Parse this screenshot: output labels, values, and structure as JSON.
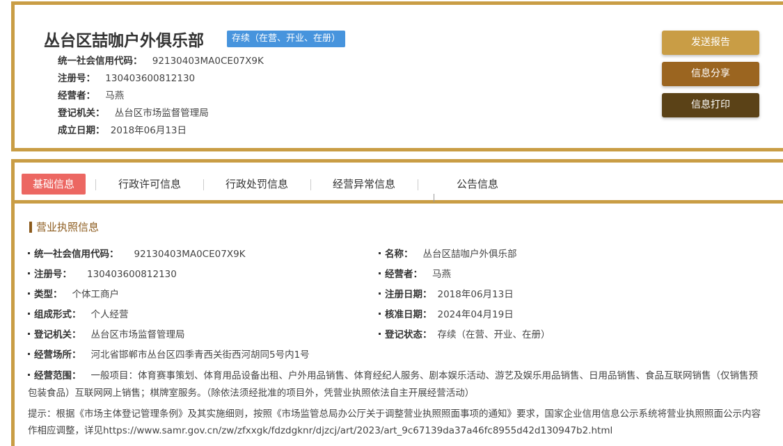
{
  "header": {
    "company_name": "丛台区喆咖户外俱乐部",
    "status_badge": "存续（在营、开业、在册）",
    "rows": [
      {
        "label": "统一社会信用代码：",
        "value": "92130403MA0CE07X9K"
      },
      {
        "label": "注册号：",
        "value": "130403600812130"
      },
      {
        "label": "经营者：",
        "value": "马燕"
      },
      {
        "label": "登记机关：",
        "value": "丛台区市场监督管理局"
      },
      {
        "label": "成立日期：",
        "value": "2018年06月13日"
      }
    ],
    "buttons": {
      "send_report": "发送报告",
      "share": "信息分享",
      "print": "信息打印"
    }
  },
  "tabs": [
    {
      "label": "基础信息",
      "active": true
    },
    {
      "label": "行政许可信息",
      "active": false
    },
    {
      "label": "行政处罚信息",
      "active": false
    },
    {
      "label": "经营异常信息",
      "active": false
    },
    {
      "label": "公告信息",
      "active": false
    }
  ],
  "section": {
    "title": "营业执照信息",
    "left": [
      {
        "label": "统一社会信用代码：",
        "value": "92130403MA0CE07X9K"
      },
      {
        "label": "注册号：",
        "value": "130403600812130"
      },
      {
        "label": "类型：",
        "value": "个体工商户"
      },
      {
        "label": "组成形式：",
        "value": "个人经营"
      },
      {
        "label": "登记机关：",
        "value": "丛台区市场监督管理局"
      },
      {
        "label": "经营场所：",
        "value": "河北省邯郸市丛台区四季青西关街西河胡同5号内1号"
      }
    ],
    "right": [
      {
        "label": "名称：",
        "value": "丛台区喆咖户外俱乐部"
      },
      {
        "label": "经营者：",
        "value": "马燕"
      },
      {
        "label": "注册日期：",
        "value": "2018年06月13日"
      },
      {
        "label": "核准日期：",
        "value": "2024年04月19日"
      },
      {
        "label": "登记状态：",
        "value": "存续（在营、开业、在册）"
      }
    ],
    "scope": {
      "label": "经营范围：",
      "value": "一般项目：体育赛事策划、体育用品设备出租、户外用品销售、体育经纪人服务、剧本娱乐活动、游艺及娱乐用品销售、日用品销售、食品互联网销售（仅销售预包装食品）互联网网上销售；棋牌室服务。（除依法须经批准的项目外，凭营业执照依法自主开展经营活动）"
    },
    "tip": "提示：根据《市场主体登记管理条例》及其实施细则，按照《市场监管总局办公厅关于调整营业执照照面事项的通知》要求，国家企业信用信息公示系统将营业执照照面公示内容作相应调整，详见https://www.samr.gov.cn/zw/zfxxgk/fdzdgknr/djzcj/art/2023/art_9c67139da37a46fc8955d42d130947b2.html"
  }
}
